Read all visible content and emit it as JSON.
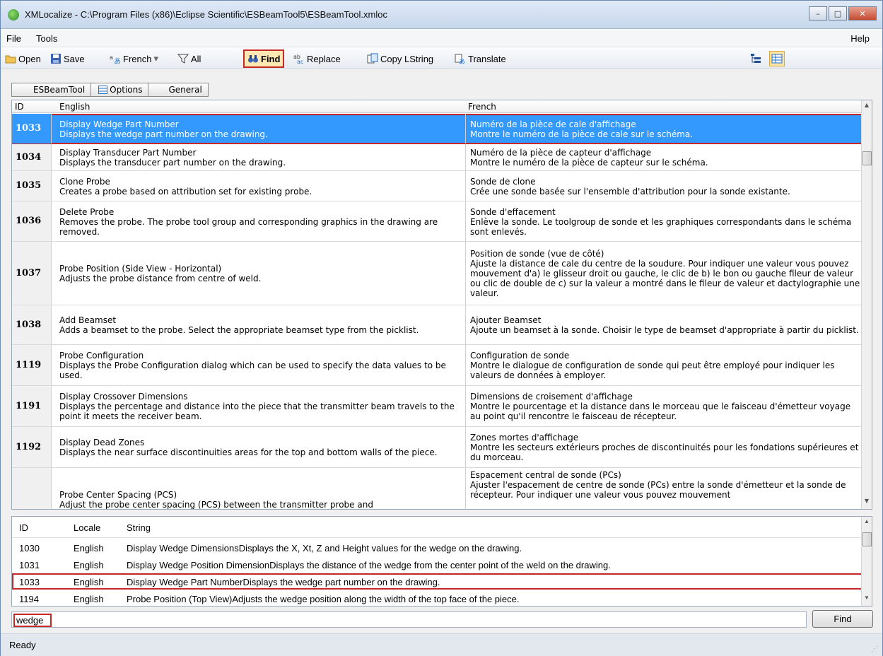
{
  "window": {
    "title": "XMLocalize - C:\\Program Files (x86)\\Eclipse Scientific\\ESBeamTool5\\ESBeamTool.xmloc",
    "minimize": "–",
    "maximize": "□",
    "close": "✕"
  },
  "menu": {
    "file": "File",
    "tools": "Tools",
    "help": "Help"
  },
  "toolbar": {
    "open": "Open",
    "save": "Save",
    "language": "French",
    "language_arrow": "▾",
    "filter": "All",
    "find": "Find",
    "replace": "Replace",
    "copy_lstring": "Copy LString",
    "translate": "Translate"
  },
  "breadcrumb": [
    "ESBeamTool",
    "Options",
    "General"
  ],
  "grid": {
    "columns": {
      "id": "ID",
      "english": "English",
      "french": "French"
    },
    "rows": [
      {
        "id": "1033",
        "en_title": "Display Wedge Part Number",
        "en_desc": "Displays the wedge part number on the drawing.",
        "fr_title": "Numéro de la pièce de cale d'affichage",
        "fr_desc": "Montre le numéro de la pièce de cale sur le schéma.",
        "selected": true
      },
      {
        "id": "1034",
        "en_title": "Display Transducer Part Number",
        "en_desc": "Displays the transducer part number on the drawing.",
        "fr_title": "Numéro de la pièce de capteur d'affichage",
        "fr_desc": "Montre le numéro de la pièce de capteur sur le schéma."
      },
      {
        "id": "1035",
        "en_title": "Clone Probe",
        "en_desc": "Creates a probe based on attribution set for existing probe.",
        "fr_title": "Sonde de clone",
        "fr_desc": "Crée une sonde basée sur l'ensemble d'attribution pour la sonde existante."
      },
      {
        "id": "1036",
        "en_title": "Delete Probe",
        "en_desc": "Removes the probe.  The probe tool group and corresponding graphics in the drawing are removed.",
        "fr_title": "Sonde d'effacement",
        "fr_desc": "Enlève la sonde.  Le toolgroup de sonde et les graphiques correspondants dans le schéma sont enlevés."
      },
      {
        "id": "1037",
        "en_title": "Probe Position (Side View - Horizontal)",
        "en_desc": "Adjusts the probe distance from centre of weld.",
        "fr_title": "Position de sonde (vue de côté)",
        "fr_desc": "Ajuste la distance de cale du centre de la soudure.  Pour indiquer une valeur vous pouvez mouvement d'a) le glisseur droit ou gauche, le clic de b) le bon ou gauche fileur de valeur ou clic de double de c) sur la valeur a montré dans le fileur de valeur et dactylographie une valeur."
      },
      {
        "id": "1038",
        "en_title": "Add Beamset",
        "en_desc": "Adds a beamset to the probe.  Select the appropriate beamset type from the picklist.",
        "fr_title": "Ajouter Beamset",
        "fr_desc": "Ajoute un beamset à la sonde. Choisir le type de beamset d'appropriate à partir du picklist."
      },
      {
        "id": "1119",
        "en_title": "Probe Configuration",
        "en_desc": "Displays the Probe Configuration dialog which can be used to specify the data values to be used.",
        "fr_title": "Configuration de sonde",
        "fr_desc": "Montre le dialogue de configuration de sonde qui peut être employé pour indiquer les valeurs de données à employer."
      },
      {
        "id": "1191",
        "en_title": "Display Crossover Dimensions",
        "en_desc": "Displays the percentage and distance into the piece that the transmitter beam travels to the point it meets the receiver beam.",
        "fr_title": "Dimensions de croisement d'affichage",
        "fr_desc": "Montre le pourcentage et la distance dans le morceau que le faisceau d'émetteur voyage au point qu'il rencontre le faisceau de récepteur."
      },
      {
        "id": "1192",
        "en_title": "Display Dead Zones",
        "en_desc": "Displays the near surface discontinuities areas for the top and bottom walls of the piece.",
        "fr_title": "Zones mortes d'affichage",
        "fr_desc": "Montre les secteurs extérieurs proches de discontinuités pour les fondations supérieures et du morceau."
      },
      {
        "id": "",
        "en_title": "Probe Center Spacing (PCS)",
        "en_desc": "Adjust the probe center spacing (PCS) between the transmitter probe and",
        "fr_title": "Espacement central de sonde (PCs)",
        "fr_desc": "Ajuster l'espacement de centre de sonde (PCs) entre la sonde d'émetteur et la sonde de récepteur.   Pour indiquer une valeur vous pouvez mouvement"
      }
    ]
  },
  "results": {
    "columns": {
      "id": "ID",
      "locale": "Locale",
      "string": "String"
    },
    "rows": [
      {
        "id": "1030",
        "locale": "English",
        "string": "Display Wedge DimensionsDisplays the X, Xt, Z and Height values for the wedge on the drawing."
      },
      {
        "id": "1031",
        "locale": "English",
        "string": "Display Wedge Position DimensionDisplays the distance of the wedge from the center point of the weld on the drawing."
      },
      {
        "id": "1033",
        "locale": "English",
        "string": "Display Wedge Part NumberDisplays the wedge part number on the drawing.",
        "highlighted": true
      },
      {
        "id": "1194",
        "locale": "English",
        "string": "Probe Position (Top View)Adjusts the wedge position along the width of the top face of the piece."
      }
    ]
  },
  "search": {
    "value": "wedge",
    "find_label": "Find"
  },
  "status": {
    "text": "Ready"
  },
  "colors": {
    "selection": "#3399ff",
    "highlight_border": "#c62828",
    "title_gradient": "#c7d7ec"
  }
}
